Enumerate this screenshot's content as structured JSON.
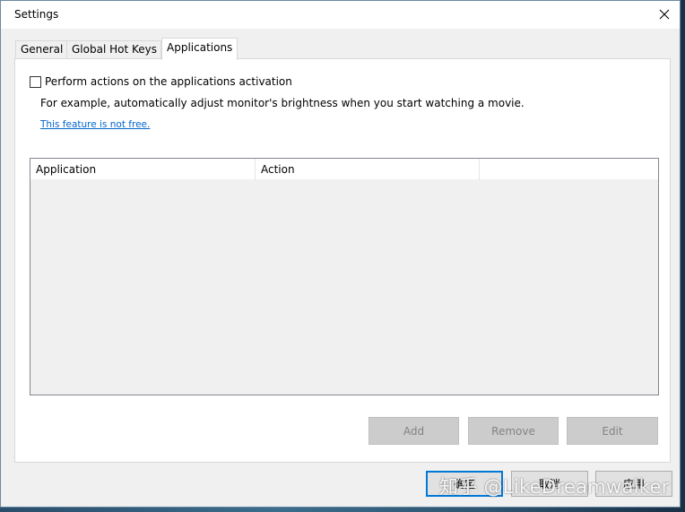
{
  "window": {
    "title": "Settings"
  },
  "tabs": [
    {
      "label": "General"
    },
    {
      "label": "Global Hot Keys"
    },
    {
      "label": "Applications",
      "selected": true
    }
  ],
  "applications": {
    "checkbox_label": "Perform actions on the applications activation",
    "checkbox_checked": false,
    "example_text": "For example, automatically adjust monitor's brightness when you start watching a movie.",
    "link_text": "This feature is not free.",
    "columns": [
      "Application",
      "Action",
      ""
    ],
    "buttons": {
      "add": "Add",
      "remove": "Remove",
      "edit": "Edit"
    }
  },
  "dialog_buttons": {
    "ok": "确定",
    "cancel": "取消",
    "apply": "应用"
  },
  "watermark": "知乎 @LikeDreamwalker",
  "icons": {
    "close": "close-icon"
  },
  "colors": {
    "accent": "#0078d7",
    "link": "#0066cc"
  }
}
